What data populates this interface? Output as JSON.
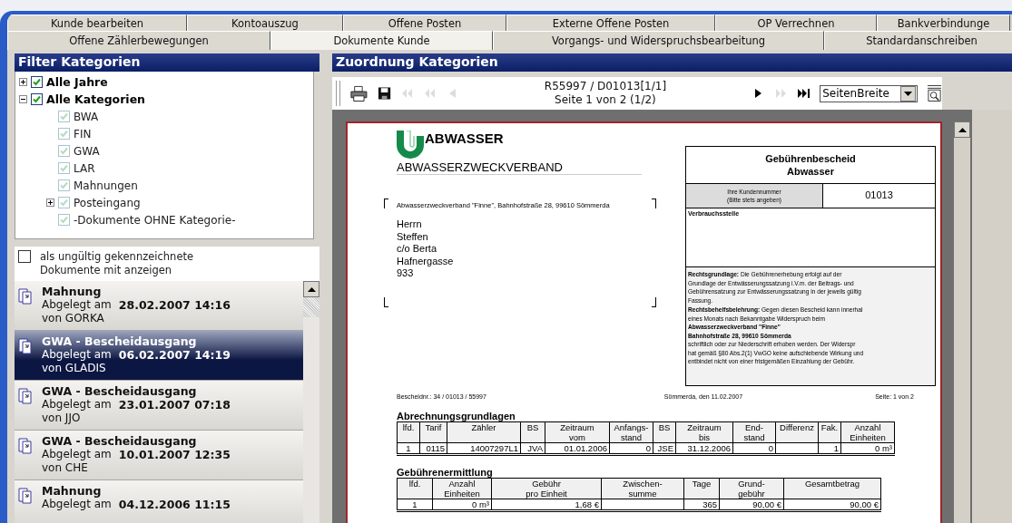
{
  "tabs_row_1": [
    {
      "label": "Kunde bearbeiten",
      "selected": false
    },
    {
      "label": "Kontoauszug",
      "selected": false
    },
    {
      "label": "Offene Posten",
      "selected": false
    },
    {
      "label": "Externe Offene Posten",
      "selected": false
    },
    {
      "label": "OP Verrechnen",
      "selected": false
    },
    {
      "label": "Bankverbindunge",
      "selected": false
    }
  ],
  "tabs_row_2": [
    {
      "label": "Offene Zählerbewegungen",
      "selected": false
    },
    {
      "label": "Dokumente Kunde",
      "selected": true
    },
    {
      "label": "Vorgangs- und Widerspruchsbearbeitung",
      "selected": false
    },
    {
      "label": "Standardanschreiben",
      "selected": false
    }
  ],
  "filter_panel": {
    "title": "Filter Kategorien",
    "tree": [
      {
        "label": "Alle Jahre",
        "checked": true,
        "disabled": false,
        "expanded": false
      },
      {
        "label": "Alle Kategorien",
        "checked": true,
        "disabled": false,
        "expanded": true,
        "children": [
          {
            "label": "BWA",
            "checked": true,
            "disabled": true
          },
          {
            "label": "FIN",
            "checked": true,
            "disabled": true
          },
          {
            "label": "GWA",
            "checked": true,
            "disabled": true
          },
          {
            "label": "LAR",
            "checked": true,
            "disabled": true
          },
          {
            "label": "Mahnungen",
            "checked": true,
            "disabled": true
          },
          {
            "label": "Posteingang",
            "checked": true,
            "disabled": true,
            "expanded": false
          },
          {
            "label": "-Dokumente OHNE Kategorie-",
            "checked": true,
            "disabled": true
          }
        ]
      }
    ]
  },
  "invalid_documents_option": {
    "label": [
      "als ungültig gekennzeichnete",
      "Dokumente mit anzeigen"
    ],
    "checked": false
  },
  "documents": [
    {
      "title": "Mahnung",
      "filed": "Abgelegt am",
      "date": "28.02.2007 14:16",
      "user": "von GORKA",
      "selected": false
    },
    {
      "title": "GWA - Bescheidausgang",
      "filed": "Abgelegt am",
      "date": "06.02.2007 14:19",
      "user": "von GLADIS",
      "selected": true
    },
    {
      "title": "GWA - Bescheidausgang",
      "filed": "Abgelegt am",
      "date": "23.01.2007 07:18",
      "user": "von JJO",
      "selected": false
    },
    {
      "title": "GWA - Bescheidausgang",
      "filed": "Abgelegt am",
      "date": "10.01.2007 12:35",
      "user": "von CHE",
      "selected": false
    },
    {
      "title": "Mahnung",
      "filed": "Abgelegt am",
      "date": "04.12.2006 11:15",
      "selected": false
    }
  ],
  "assignment_panel": {
    "title": "Zuordnung Kategorien",
    "toolbar": {
      "document_id": "R55997 / D01013[1/1]",
      "page_info": "Seite 1 von 2 (1/2)",
      "zoom": "SeitenBreite",
      "nav_buttons": [
        {
          "kind": "first",
          "disabled": true
        },
        {
          "kind": "previous-group",
          "disabled": true
        },
        {
          "kind": "previous",
          "disabled": true
        },
        {
          "kind": "next",
          "disabled": false
        },
        {
          "kind": "next-group",
          "disabled": true
        },
        {
          "kind": "last",
          "disabled": false
        }
      ]
    }
  },
  "document": {
    "logo_word": "ABWASSER",
    "organisation": "ABWASSERZWECKVERBAND",
    "sender_line": "Abwasserzweckverband \"Finne\", Bahnhofstraße 28, 99610 Sömmerda",
    "address": [
      "Herrn",
      "Steffen",
      "c/o Berta",
      "Hafnergasse",
      "933"
    ],
    "notice_title": [
      "Gebührenbescheid",
      "Abwasser"
    ],
    "customer_number_label": [
      "Ihre Kundennummer",
      "(Bitte stets angeben)"
    ],
    "customer_number": "01013",
    "consumption_point_label": "Verbrauchsstelle",
    "legal_text": [
      [
        "**Rechtsgrundlage:** Die Gebührenerhebung erfolgt auf der",
        "Grundlage der Entwässerungssatzung i.V.m. der Beitrags- und",
        "Gebührensatzung zur Entwässerungssatzung in der jeweils gültig",
        "Fassung."
      ],
      [
        "**Rechtsbehelfsbelehrung:** Gegen diesen Bescheid kann innerhal",
        "eines Monats nach Bekanntgabe Widerspruch beim",
        "**Abwasserzweckverband \"Finne\"**",
        "**Bahnhofstraße 28, 99610 Sömmerda**",
        "schriftlich oder zur Niederschrift erhoben werden. Der Widerspr",
        "hat gemäß §80 Abs.2(1) VwGO keine aufschiebende Wirkung und",
        "entbindet nicht von einer fristgemäßen Einzahlung der Gebühr."
      ]
    ],
    "notice_number": "Bescheidnr.: 34 / 01013 / 55997",
    "place_date": "Sömmerda, den 11.02.2007",
    "page": "Seite: 1 von 2",
    "billing_basis": {
      "heading": "Abrechnungsgrundlagen",
      "columns": [
        "lfd.",
        "Tarif",
        "Zähler",
        "BS",
        "Zeitraum\nvom",
        "Anfangs-\nstand",
        "BS",
        "Zeitraum\nbis",
        "End-\nstand",
        "Differenz",
        "Fak.",
        "Anzahl\nEinheiten"
      ],
      "rows": [
        [
          "1",
          "0115",
          "14007297L1",
          "JVA",
          "01.01.2006",
          "0",
          "JSE",
          "31.12.2006",
          "0",
          null,
          "1",
          "0 m³"
        ]
      ]
    },
    "fee_calculation": {
      "heading": "Gebührenermittlung",
      "columns": [
        "lfd.",
        "Anzahl\nEinheiten",
        "Gebühr\npro Einheit",
        "Zwischen-\nsumme",
        "Tage",
        "Grund-\ngebühr",
        "Gesamtbetrag"
      ],
      "rows": [
        [
          "1",
          "0 m³",
          "1,68 €",
          null,
          "365",
          "90,00 €",
          "90,00 €"
        ]
      ]
    }
  }
}
